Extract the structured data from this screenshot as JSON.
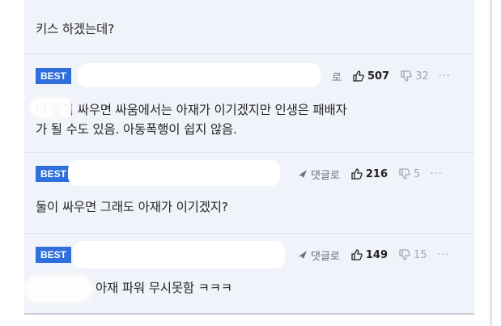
{
  "comments": [
    {
      "text": "키스 하겠는데?"
    },
    {
      "badge": "BEST",
      "reply_label": "로",
      "likes": "507",
      "dislikes": "32",
      "more": "···",
      "text_line1": "너 둘이 싸우면 싸움에서는 아재가 이기겠지만 인생은 패배자",
      "text_line2": "가 될 수도 있음. 아동폭행이 쉽지 않음."
    },
    {
      "badge": "BEST",
      "reply_label": "댓글로",
      "likes": "216",
      "dislikes": "5",
      "more": "···",
      "text": "둘이 싸우면 그래도 아재가 이기겠지?"
    },
    {
      "badge": "BEST",
      "reply_label": "댓글로",
      "likes": "149",
      "dislikes": "15",
      "more": "···",
      "text": "아재 파워 무시못함 ㅋㅋㅋ"
    }
  ],
  "icons": {
    "reply": "reply-arrow-icon",
    "like": "thumbs-up-icon",
    "dislike": "thumbs-down-icon",
    "more": "more-icon"
  },
  "colors": {
    "badge": "#2f6fdc",
    "panel": "#f0f3f9"
  }
}
